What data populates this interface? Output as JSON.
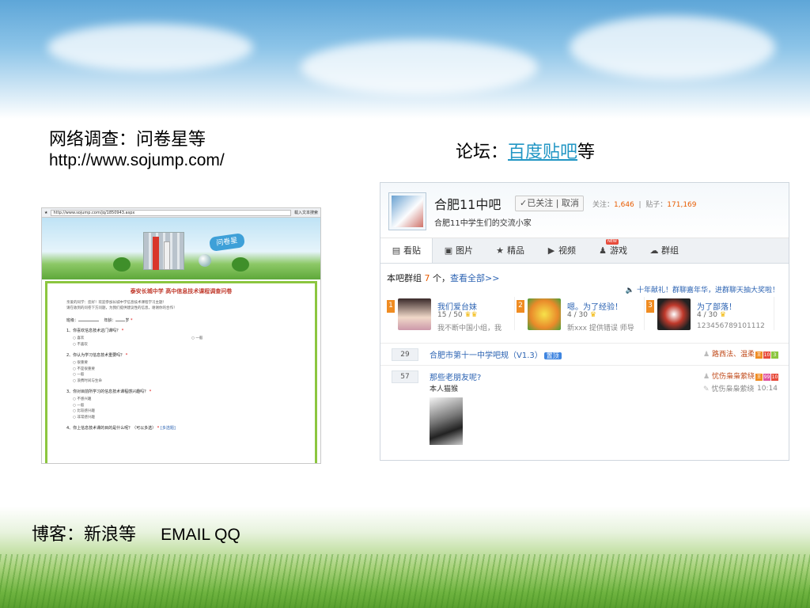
{
  "slide": {
    "survey_title": "网络调查：问卷星等",
    "survey_url": "http://www.sojump.com/",
    "forum_prefix": "论坛：",
    "forum_link": "百度贴吧",
    "forum_suffix": "等",
    "blog_label": "博客：新浪等",
    "contacts": "EMAIL  QQ"
  },
  "survey_screenshot": {
    "address": "http://www.sojump.com/jq/1850943.aspx",
    "toolbar_right": "载入文本搜索",
    "logo_text": "问卷星",
    "form_title": "泰安长城中学  高中信息技术课程调查问卷",
    "intro_line1": "亲爱的同学：您好！欢迎参加长城中学信息技术课程学习主题！",
    "intro_line2": "请在收到的问卷下方问题，为我们提供建议性的信息，谢谢你的合作！",
    "field_class": "班级：",
    "field_age": "年龄：",
    "field_age_unit": "岁",
    "q1": "1、你喜欢信息技术这门课吗？",
    "q1_opts": [
      "喜欢",
      "一般",
      "不喜欢"
    ],
    "q2": "2、你认为学习信息技术重要吗？",
    "q2_opts": [
      "很重要",
      "不是很重要",
      "一般",
      "浪费时间与生命"
    ],
    "q3": "3、你对目前所学习的信息技术课程感兴趣吗？",
    "q3_opts": [
      "不感兴趣",
      "一般",
      "比较感兴趣",
      "非常感兴趣"
    ],
    "q4": "4、你上信息技术课的目的是什么呢？（可以多选）",
    "q4_tag": "[多选题]",
    "star": "*"
  },
  "tieba_screenshot": {
    "forum_name": "合肥11中吧",
    "follow_label": "✓已关注",
    "unfollow_label": "取消",
    "followers_label": "关注：",
    "followers": "1,646",
    "posts_label": "贴子：",
    "posts": "171,169",
    "description": "合肥11中学生们的交流小家",
    "tabs": [
      {
        "icon": "▤",
        "label": "看贴"
      },
      {
        "icon": "▣",
        "label": "图片"
      },
      {
        "icon": "★",
        "label": "精品"
      },
      {
        "icon": "▶",
        "label": "视频"
      },
      {
        "icon": "♟",
        "label": "游戏"
      },
      {
        "icon": "☁",
        "label": "群组"
      }
    ],
    "new_badge": "NEW",
    "group_prefix": "本吧群组",
    "group_count": "7",
    "group_unit": "个，",
    "group_link": "查看全部>>",
    "announcement": "🔈 十年献礼！群聊嘉年华，进群聊天抽大奖啦！",
    "groups": [
      {
        "rank": "1",
        "name": "我们爱台妹",
        "stat": "15 / 50",
        "desc": "我不断中国小组，我"
      },
      {
        "rank": "2",
        "name": "嗯。为了经验！",
        "stat": "4 / 30",
        "desc": "新xxx 提供错误 师导"
      },
      {
        "rank": "3",
        "name": "为了部落！",
        "stat": "4 / 30",
        "desc": "123456789101112"
      }
    ],
    "threads": [
      {
        "replies": "29",
        "title": "合肥市第十一中学吧规（V1.3）",
        "tag": "置顶",
        "author": "路西法、温柔",
        "body": "",
        "last": "",
        "time": ""
      },
      {
        "replies": "57",
        "title": "那些老朋友呢?",
        "tag": "",
        "author": "忧伤枭枭萦绕",
        "body": "本人猫猴",
        "last": "忧伤枭枭萦绕",
        "time": "10:14"
      }
    ]
  }
}
